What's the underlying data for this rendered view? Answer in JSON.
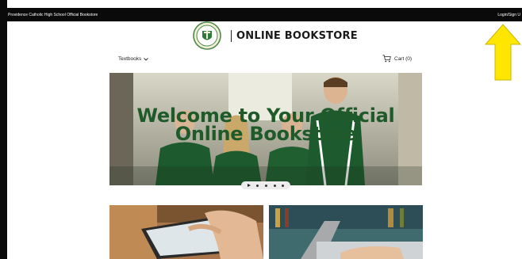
{
  "topbar": {
    "store_name": "Providence Catholic High School Official Bookstore",
    "login_label": "Login/Sign U"
  },
  "header": {
    "logo_icon": "school-seal-icon",
    "title": "ONLINE BOOKSTORE"
  },
  "nav": {
    "textbooks_label": "Textbooks",
    "cart_label": "Cart (0)",
    "cart_icon": "shopping-cart-icon",
    "dropdown_icon": "chevron-down-icon"
  },
  "hero": {
    "title": "Welcome to Your Official Online Bookstore",
    "title_color": "#1f5a2a"
  },
  "slider": {
    "play_icon": "play-icon",
    "dot_count": 4
  },
  "cards": [
    {
      "image": "tablet-reading-photo"
    },
    {
      "image": "laptop-typing-photo"
    }
  ],
  "annotation": {
    "arrow_color": "#ffe600",
    "arrow_icon": "up-arrow-icon"
  },
  "colors": {
    "topbar_bg": "#0a0a0a",
    "accent_green": "#1f5a2a"
  }
}
